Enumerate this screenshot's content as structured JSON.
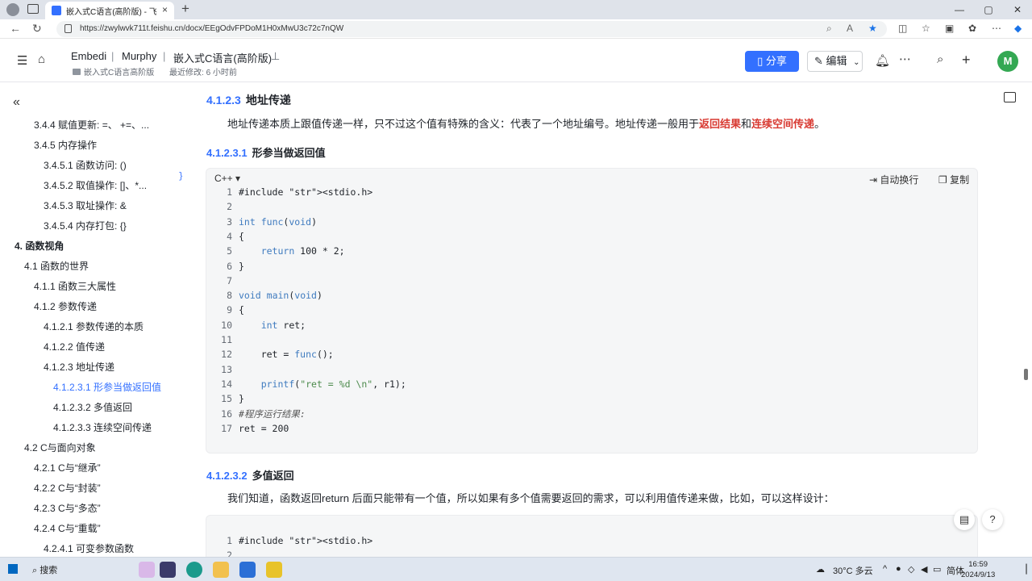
{
  "browser": {
    "tab_title": "嵌入式C语言(高阶版) - 飞书云文档",
    "tab_close": "×",
    "new_tab": "+",
    "url": "https://zwylwvk711t.feishu.cn/docx/EEgOdvFPDoM1H0xMwU3c72c7nQW",
    "window_controls": [
      "—",
      "▢",
      "✕"
    ]
  },
  "header": {
    "breadcrumb": [
      "Embedi",
      "Murphy",
      "嵌入式C语言(高阶版)"
    ],
    "pin_icon": "pin-icon",
    "folder": "嵌入式C语言高阶版",
    "last_modified": "最近修改: 6 小时前",
    "share_label": "分享",
    "edit_label": "编辑",
    "avatar": "M"
  },
  "sidebar": {
    "items": [
      {
        "label": "3.4.4 赋值更新: =、 +=、..."
      },
      {
        "label": "3.4.5 内存操作"
      },
      {
        "label": "3.4.5.1 函数访问: ()"
      },
      {
        "label": "3.4.5.2 取值操作: []、*..."
      },
      {
        "label": "3.4.5.3 取址操作: &"
      },
      {
        "label": "3.4.5.4 内存打包: {}"
      },
      {
        "label": "4. 函数视角"
      },
      {
        "label": "4.1 函数的世界"
      },
      {
        "label": "4.1.1 函数三大属性"
      },
      {
        "label": "4.1.2 参数传递"
      },
      {
        "label": "4.1.2.1 参数传递的本质"
      },
      {
        "label": "4.1.2.2 值传递"
      },
      {
        "label": "4.1.2.3 地址传递"
      },
      {
        "label": "4.1.2.3.1 形参当做返回值"
      },
      {
        "label": "4.1.2.3.2 多值返回"
      },
      {
        "label": "4.1.2.3.3 连续空间传递"
      },
      {
        "label": "4.2 C与面向对象"
      },
      {
        "label": "4.2.1 C与“继承”"
      },
      {
        "label": "4.2.2 C与“封装”"
      },
      {
        "label": "4.2.3 C与“多态”"
      },
      {
        "label": "4.2.4 C与“重载”"
      },
      {
        "label": "4.2.4.1 可变参数函数"
      }
    ]
  },
  "doc": {
    "h3_num": "4.1.2.3",
    "h3_title": "地址传递",
    "para1_a": "地址传递本质上跟值传递一样，只不过这个值有特殊的含义：代表了一个地址编号。地址传递一般用于",
    "para1_red1": "返回结果",
    "para1_b": "和",
    "para1_red2": "连续空间传递",
    "para1_c": "。",
    "h4a_num": "4.1.2.3.1",
    "h4a_title": "形参当做返回值",
    "code_lang": "C++",
    "code_wrap": "自动换行",
    "code_copy": "复制",
    "code_tag": "{}",
    "code1": [
      {
        "n": "1",
        "t": "#include <stdio.h>"
      },
      {
        "n": "2",
        "t": ""
      },
      {
        "n": "3",
        "t": "int func(void)"
      },
      {
        "n": "4",
        "t": "{"
      },
      {
        "n": "5",
        "t": "    return 100 * 2;"
      },
      {
        "n": "6",
        "t": "}"
      },
      {
        "n": "7",
        "t": ""
      },
      {
        "n": "8",
        "t": "void main(void)"
      },
      {
        "n": "9",
        "t": "{"
      },
      {
        "n": "10",
        "t": "    int ret;"
      },
      {
        "n": "11",
        "t": ""
      },
      {
        "n": "12",
        "t": "    ret = func();"
      },
      {
        "n": "13",
        "t": ""
      },
      {
        "n": "14",
        "t": "    printf(\"ret = %d \\n\", r1);"
      },
      {
        "n": "15",
        "t": "}"
      },
      {
        "n": "16",
        "t": "#程序运行结果:"
      },
      {
        "n": "17",
        "t": "ret = 200"
      }
    ],
    "h4b_num": "4.1.2.3.2",
    "h4b_title": "多值返回",
    "para2": "我们知道，函数返回return 后面只能带有一个值，所以如果有多个值需要返回的需求，可以利用值传递来做，比如，可以这样设计：",
    "code2": [
      {
        "n": "1",
        "t": "#include <stdio.h>"
      },
      {
        "n": "2",
        "t": ""
      }
    ]
  },
  "taskbar": {
    "search": "搜索",
    "weather": "30°C 多云",
    "ime": "简体",
    "time": "16:59",
    "date": "2024/9/13"
  }
}
